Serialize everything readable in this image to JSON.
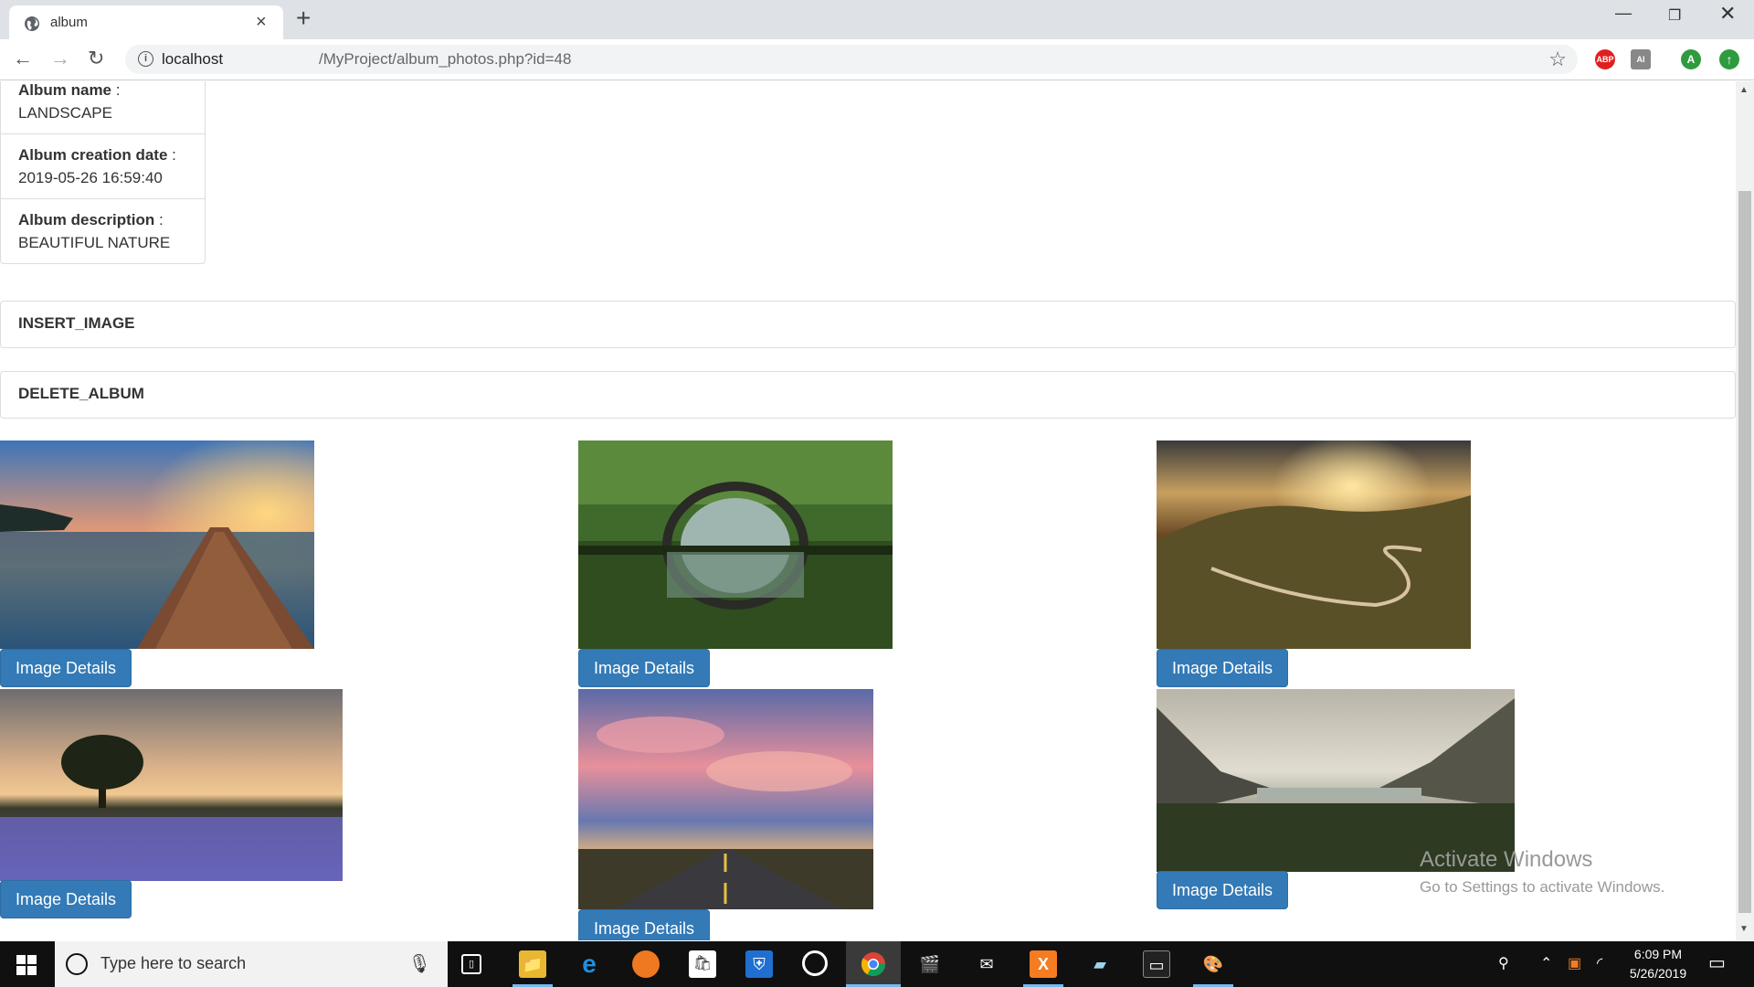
{
  "browser": {
    "tab_title": "album",
    "url_host": "localhost",
    "url_path": "/MyProject/album_photos.php?id=48",
    "extensions": [
      "ABP",
      "AI"
    ]
  },
  "album": {
    "name_label": "Album name",
    "name_sep": " :",
    "name_value": "LANDSCAPE",
    "date_label": "Album creation date",
    "date_sep": " :",
    "date_value": "2019-05-26 16:59:40",
    "desc_label": "Album description",
    "desc_sep": " :",
    "desc_value": "BEAUTIFUL NATURE"
  },
  "actions": {
    "insert_image": "INSERT_IMAGE",
    "delete_album": "DELETE_ALBUM"
  },
  "photos": {
    "button_label": "Image Details",
    "items": [
      "lake-pier-sunset",
      "stone-arch-bridge",
      "winding-valley-road",
      "tree-lavender-field",
      "road-pink-clouds",
      "mountain-lake"
    ]
  },
  "watermark": {
    "title": "Activate Windows",
    "subtitle": "Go to Settings to activate Windows."
  },
  "taskbar": {
    "search_placeholder": "Type here to search",
    "time": "6:09 PM",
    "date": "5/26/2019"
  },
  "colors": {
    "button_primary": "#337ab7",
    "taskbar": "#101010",
    "tab_strip": "#dee1e6"
  }
}
